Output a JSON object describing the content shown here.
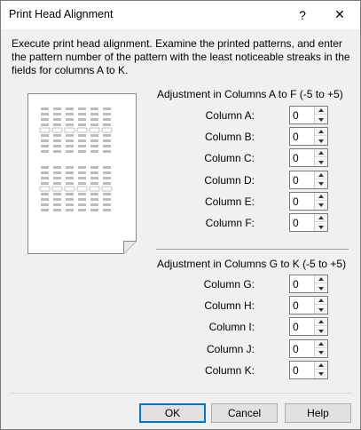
{
  "window": {
    "title": "Print Head Alignment",
    "help_glyph": "?",
    "close_glyph": "✕"
  },
  "description": "Execute print head alignment. Examine the printed patterns, and enter the pattern number of the pattern with the least noticeable streaks in the fields for columns A to K.",
  "group1": {
    "label": "Adjustment in Columns A to F (-5 to +5)",
    "rows": [
      {
        "label": "Column A:",
        "value": "0"
      },
      {
        "label": "Column B:",
        "value": "0"
      },
      {
        "label": "Column C:",
        "value": "0"
      },
      {
        "label": "Column D:",
        "value": "0"
      },
      {
        "label": "Column E:",
        "value": "0"
      },
      {
        "label": "Column F:",
        "value": "0"
      }
    ]
  },
  "group2": {
    "label": "Adjustment in Columns G to K (-5 to +5)",
    "rows": [
      {
        "label": "Column G:",
        "value": "0"
      },
      {
        "label": "Column H:",
        "value": "0"
      },
      {
        "label": "Column I:",
        "value": "0"
      },
      {
        "label": "Column J:",
        "value": "0"
      },
      {
        "label": "Column K:",
        "value": "0"
      }
    ]
  },
  "buttons": {
    "ok": "OK",
    "cancel": "Cancel",
    "help": "Help"
  },
  "colors": {
    "accent": "#0078d7",
    "pattern_gray": "#bdbdbd"
  }
}
